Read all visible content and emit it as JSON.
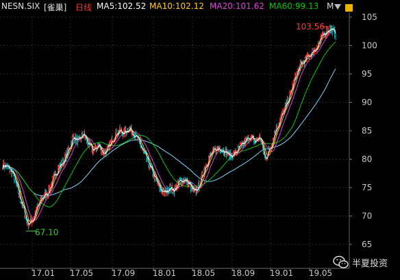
{
  "header": {
    "symbol": "NESN.SIX",
    "adjust": "[雀巢]",
    "period": "日线",
    "ma5": "MA5:102.52",
    "ma10": "MA10:102.12",
    "ma20": "MA20:101.62",
    "ma60": "MA60:99.13",
    "menu_glyph": "M"
  },
  "watermark": {
    "text": "半夏投资"
  },
  "colors": {
    "background": "#000000",
    "grid": "#2a2a2a",
    "axis_text": "#c8c8c8",
    "up_candle": "#ff2a2a",
    "down_candle": "#00d4d4",
    "ma5": "#ffffff",
    "ma10": "#ffd000",
    "ma20": "#e040e0",
    "ma60": "#00cc00",
    "ma120": "#7fd8ff",
    "high_label": "#ff3c3c",
    "low_label": "#35d035",
    "symbol_text": "#e0e0e0"
  },
  "chart_data": {
    "type": "candlestick",
    "title": "NESN.SIX",
    "ylim": [
      64,
      107
    ],
    "y_ticks": [
      65,
      70,
      75,
      80,
      85,
      90,
      95,
      100,
      105
    ],
    "x_ticks": [
      "17.01",
      "17.05",
      "17.09",
      "18.01",
      "18.05",
      "18.09",
      "19.01",
      "19.05"
    ],
    "annotations": {
      "high": "103.56",
      "low": "67.10"
    },
    "close_path": [
      {
        "x": "16.11",
        "y": 79.0
      },
      {
        "x": "16.11",
        "y": 78.5
      },
      {
        "x": "16.12",
        "y": 77.5
      },
      {
        "x": "16.12",
        "y": 74.5
      },
      {
        "x": "16.12",
        "y": 71.5
      },
      {
        "x": "16.12",
        "y": 68.5
      },
      {
        "x": "17.01",
        "y": 69.5
      },
      {
        "x": "17.01",
        "y": 71.8
      },
      {
        "x": "17.01",
        "y": 73.5
      },
      {
        "x": "17.02",
        "y": 74.2
      },
      {
        "x": "17.03",
        "y": 76.5
      },
      {
        "x": "17.03",
        "y": 78.5
      },
      {
        "x": "17.04",
        "y": 79.5
      },
      {
        "x": "17.04",
        "y": 81.5
      },
      {
        "x": "17.05",
        "y": 84.0
      },
      {
        "x": "17.05",
        "y": 83.0
      },
      {
        "x": "17.06",
        "y": 84.5
      },
      {
        "x": "17.06",
        "y": 82.5
      },
      {
        "x": "17.07",
        "y": 81.5
      },
      {
        "x": "17.07",
        "y": 82.5
      },
      {
        "x": "17.08",
        "y": 81.0
      },
      {
        "x": "17.08",
        "y": 82.0
      },
      {
        "x": "17.09",
        "y": 84.0
      },
      {
        "x": "17.09",
        "y": 85.0
      },
      {
        "x": "17.10",
        "y": 84.5
      },
      {
        "x": "17.10",
        "y": 85.5
      },
      {
        "x": "17.11",
        "y": 84.5
      },
      {
        "x": "17.11",
        "y": 83.0
      },
      {
        "x": "17.12",
        "y": 81.0
      },
      {
        "x": "17.12",
        "y": 79.0
      },
      {
        "x": "18.01",
        "y": 77.0
      },
      {
        "x": "18.01",
        "y": 75.0
      },
      {
        "x": "18.02",
        "y": 74.0
      },
      {
        "x": "18.02",
        "y": 75.0
      },
      {
        "x": "18.03",
        "y": 74.5
      },
      {
        "x": "18.03",
        "y": 76.0
      },
      {
        "x": "18.04",
        "y": 76.5
      },
      {
        "x": "18.04",
        "y": 75.5
      },
      {
        "x": "18.05",
        "y": 74.0
      },
      {
        "x": "18.05",
        "y": 75.5
      },
      {
        "x": "18.06",
        "y": 78.5
      },
      {
        "x": "18.06",
        "y": 80.5
      },
      {
        "x": "18.07",
        "y": 81.5
      },
      {
        "x": "18.07",
        "y": 82.0
      },
      {
        "x": "18.08",
        "y": 81.5
      },
      {
        "x": "18.08",
        "y": 80.5
      },
      {
        "x": "18.09",
        "y": 81.0
      },
      {
        "x": "18.09",
        "y": 82.0
      },
      {
        "x": "18.10",
        "y": 83.0
      },
      {
        "x": "18.10",
        "y": 84.0
      },
      {
        "x": "18.11",
        "y": 83.0
      },
      {
        "x": "18.11",
        "y": 84.0
      },
      {
        "x": "18.12",
        "y": 80.0
      },
      {
        "x": "18.12",
        "y": 82.0
      },
      {
        "x": "19.01",
        "y": 85.0
      },
      {
        "x": "19.01",
        "y": 87.0
      },
      {
        "x": "19.02",
        "y": 89.0
      },
      {
        "x": "19.02",
        "y": 91.5
      },
      {
        "x": "19.03",
        "y": 94.5
      },
      {
        "x": "19.03",
        "y": 96.5
      },
      {
        "x": "19.04",
        "y": 97.5
      },
      {
        "x": "19.04",
        "y": 98.5
      },
      {
        "x": "19.05",
        "y": 99.5
      },
      {
        "x": "19.05",
        "y": 101.0
      },
      {
        "x": "19.06",
        "y": 102.5
      },
      {
        "x": "19.06",
        "y": 103.0
      },
      {
        "x": "19.06",
        "y": 102.0
      }
    ]
  }
}
